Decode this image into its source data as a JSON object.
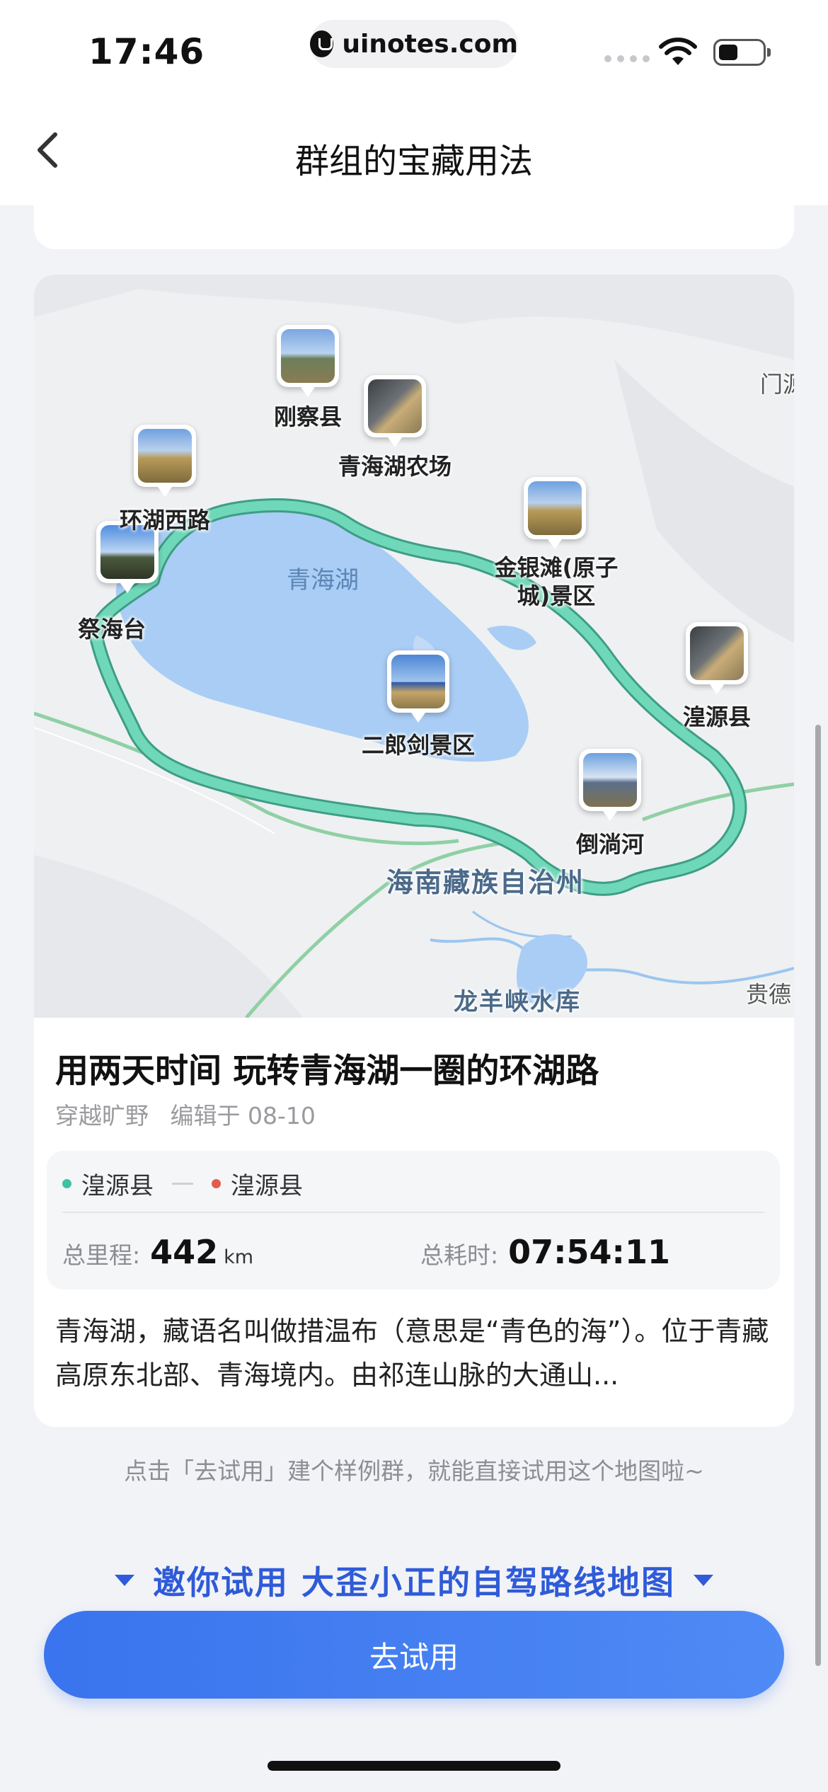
{
  "status_bar": {
    "time": "17:46",
    "url": "uinotes.com",
    "icons": [
      "signal-dots-icon",
      "wifi-icon",
      "battery-icon"
    ]
  },
  "nav": {
    "back_icon": "chevron-left-icon",
    "title": "群组的宝藏用法"
  },
  "map": {
    "route_color": "#5ccfae",
    "lake_color": "#a9cdf5",
    "lake_name": "青海湖",
    "region_name": "海南藏族自治州",
    "reservoir_name": "龙羊峡水库",
    "edge_labels": [
      "门源",
      "贵德"
    ],
    "places": [
      {
        "name": "刚察县",
        "photo": "sky"
      },
      {
        "name": "青海湖农场",
        "photo": "car"
      },
      {
        "name": "环湖西路",
        "photo": "gold"
      },
      {
        "name": "祭海台",
        "photo": "tent"
      },
      {
        "name": "金银滩(原子\n城)景区",
        "photo": "gold"
      },
      {
        "name": "湟源县",
        "photo": "car"
      },
      {
        "name": "二郎剑景区",
        "photo": "lakeview"
      },
      {
        "name": "倒淌河",
        "photo": "mountain"
      }
    ]
  },
  "card": {
    "title": "用两天时间 玩转青海湖一圈的环湖路",
    "author": "穿越旷野",
    "edited": "编辑于 08-10",
    "route_start": "湟源县",
    "route_end": "湟源县",
    "distance_label": "总里程:",
    "distance_value": "442",
    "distance_unit": "km",
    "duration_label": "总耗时:",
    "duration_value": "07:54:11",
    "description": "青海湖，藏语名叫做措温布（意思是“青色的海”）。位于青藏高原东北部、青海境内。由祁连山脉的大通山..."
  },
  "hint": "点击「去试用」建个样例群，就能直接试用这个地图啦~",
  "invite_text": "邀你试用 大歪小正的自驾路线地图",
  "cta_label": "去试用",
  "colors": {
    "accent": "#3a74ee",
    "route_start_dot": "#3ec2a0",
    "route_end_dot": "#e45a4d"
  }
}
